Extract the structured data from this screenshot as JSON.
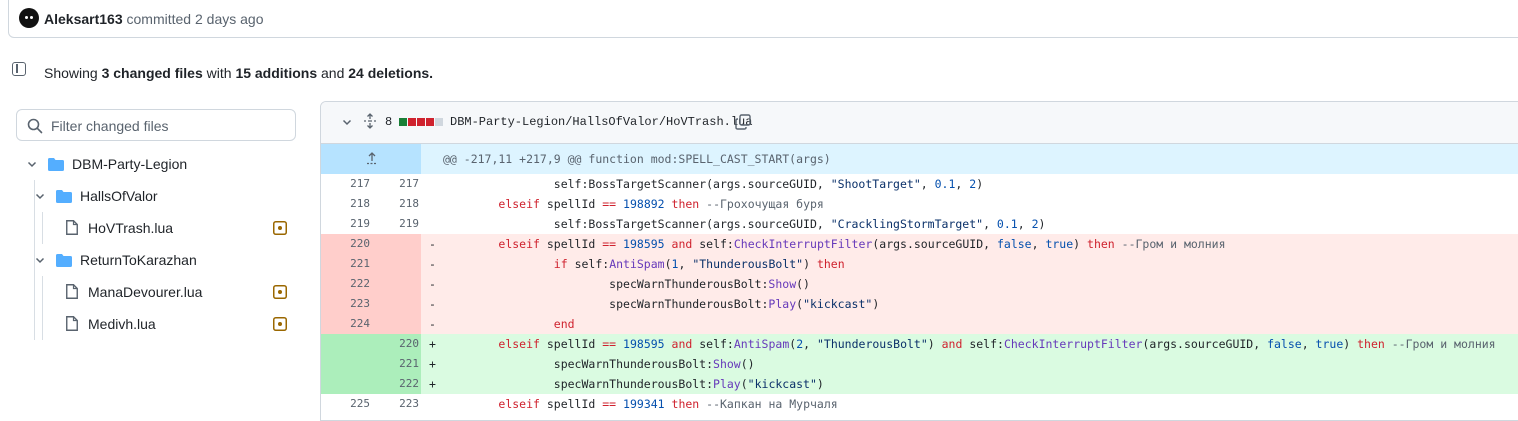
{
  "commit": {
    "author": "Aleksart163",
    "action": "committed",
    "time": "2 days ago"
  },
  "summary": {
    "showing": "Showing",
    "files": "3 changed files",
    "with": "with",
    "additions": "15 additions",
    "and": "and",
    "deletions": "24 deletions."
  },
  "filter": {
    "placeholder": "Filter changed files"
  },
  "tree": {
    "root": "DBM-Party-Legion",
    "folder1": "HallsOfValor",
    "file1": "HoVTrash.lua",
    "folder2": "ReturnToKarazhan",
    "file2": "ManaDevourer.lua",
    "file3": "Medivh.lua"
  },
  "file_header": {
    "change_count": "8",
    "path": "DBM-Party-Legion/HallsOfValor/HoVTrash.lua",
    "diffstat_colors": [
      "#1a7f37",
      "#cf222e",
      "#cf222e",
      "#cf222e",
      "#d0d7de"
    ]
  },
  "hunk_header": "@@ -217,11 +217,9 @@ function mod:SPELL_CAST_START(args)",
  "lines": [
    {
      "old": "217",
      "new": "217",
      "marker": "",
      "type": "ctx"
    },
    {
      "old": "218",
      "new": "218",
      "marker": "",
      "type": "ctx"
    },
    {
      "old": "219",
      "new": "219",
      "marker": "",
      "type": "ctx"
    },
    {
      "old": "220",
      "new": "",
      "marker": "-",
      "type": "del"
    },
    {
      "old": "221",
      "new": "",
      "marker": "-",
      "type": "del"
    },
    {
      "old": "222",
      "new": "",
      "marker": "-",
      "type": "del"
    },
    {
      "old": "223",
      "new": "",
      "marker": "-",
      "type": "del"
    },
    {
      "old": "224",
      "new": "",
      "marker": "-",
      "type": "del"
    },
    {
      "old": "",
      "new": "220",
      "marker": "+",
      "type": "add"
    },
    {
      "old": "",
      "new": "221",
      "marker": "+",
      "type": "add"
    },
    {
      "old": "",
      "new": "222",
      "marker": "+",
      "type": "add"
    },
    {
      "old": "225",
      "new": "223",
      "marker": "",
      "type": "ctx"
    }
  ],
  "code": {
    "l0": {
      "a": "self:BossTargetScanner(args.sourceGUID, ",
      "b": "\"ShootTarget\"",
      "c": ", ",
      "d": "0.1",
      "e": ", ",
      "f": "2",
      "g": ")"
    },
    "l1": {
      "a": "elseif",
      "b": " spellId ",
      "c": "==",
      "d": " ",
      "e": "198892",
      "f": " ",
      "g": "then",
      "h": " --Грохочущая буря"
    },
    "l2": {
      "a": "self:BossTargetScanner(args.sourceGUID, ",
      "b": "\"CracklingStormTarget\"",
      "c": ", ",
      "d": "0.1",
      "e": ", ",
      "f": "2",
      "g": ")"
    },
    "l3": {
      "a": "elseif",
      "b": " spellId ",
      "c": "==",
      "d": " ",
      "e": "198595",
      "f": " ",
      "g": "and",
      "h": " self:",
      "i": "CheckInterruptFilter",
      "j": "(args.sourceGUID, ",
      "k": "false",
      "l": ", ",
      "m": "true",
      "n": ") ",
      "o": "then",
      "p": " --Гром и молния"
    },
    "l4": {
      "a": "if",
      "b": " self:",
      "c": "AntiSpam",
      "d": "(",
      "e": "1",
      "f": ", ",
      "g": "\"ThunderousBolt\"",
      "h": ") ",
      "i": "then"
    },
    "l5": {
      "a": "specWarnThunderousBolt:",
      "b": "Show",
      "c": "()"
    },
    "l6": {
      "a": "specWarnThunderousBolt:",
      "b": "Play",
      "c": "(",
      "d": "\"kickcast\"",
      "e": ")"
    },
    "l7": {
      "a": "end"
    },
    "l8": {
      "a": "elseif",
      "b": " spellId ",
      "c": "==",
      "d": " ",
      "e": "198595",
      "f": " ",
      "g": "and",
      "h": " self:",
      "i": "AntiSpam",
      "j": "(",
      "k": "2",
      "l": ", ",
      "m": "\"ThunderousBolt\"",
      "n": ") ",
      "o": "and",
      "p": " self:",
      "q": "CheckInterruptFilter",
      "r": "(args.sourceGUID, ",
      "s": "false",
      "t": ", ",
      "u": "true",
      "v": ") ",
      "w": "then",
      "x": " --Гром и молния"
    },
    "l9": {
      "a": "specWarnThunderousBolt:",
      "b": "Show",
      "c": "()"
    },
    "l10": {
      "a": "specWarnThunderousBolt:",
      "b": "Play",
      "c": "(",
      "d": "\"kickcast\"",
      "e": ")"
    },
    "l11": {
      "a": "elseif",
      "b": " spellId ",
      "c": "==",
      "d": " ",
      "e": "199341",
      "f": " ",
      "g": "then",
      "h": " --Капкан на Мурчаля"
    }
  },
  "colors": {
    "add_bg": "#dafbe1",
    "add_num_bg": "#aceebb",
    "del_bg": "#ffebe9",
    "del_num_bg": "#ffcecb",
    "hunk_bg": "#ddf4ff",
    "folder": "#54aeff",
    "modified": "#9a6700"
  }
}
